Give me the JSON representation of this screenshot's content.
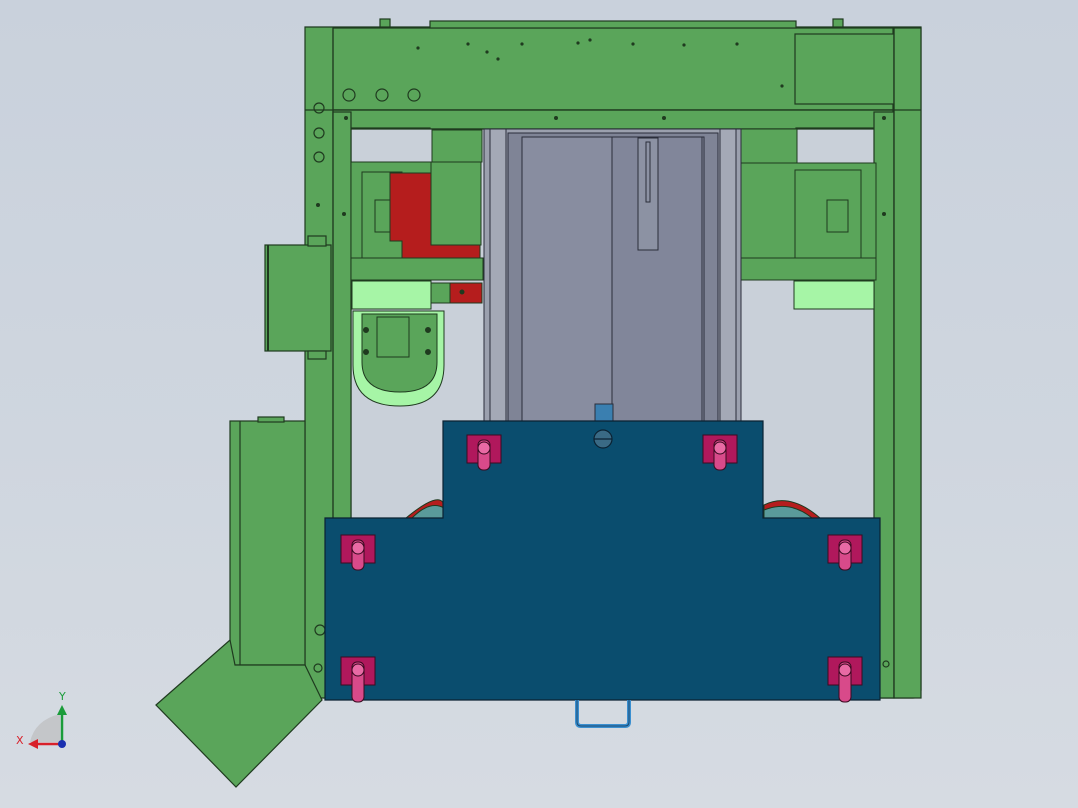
{
  "viewport": {
    "background_top": "#c9d1dc",
    "background_bottom": "#d6dbe2"
  },
  "model": {
    "frame_color": "#5aa55a",
    "frame_edge": "#1f3a1f",
    "light_green": "#a6f5a6",
    "red_block": "#b51d1d",
    "gray_channel": "#7f8496",
    "blue_plate": "#0a4d6e",
    "clamp_color": "#b0185c",
    "handle_color": "#3a8fd0"
  },
  "triad": {
    "x_label": "X",
    "y_label": "Y",
    "x_color": "#d8202a",
    "y_color": "#1a9c3a",
    "z_color": "#1a2fb0"
  }
}
